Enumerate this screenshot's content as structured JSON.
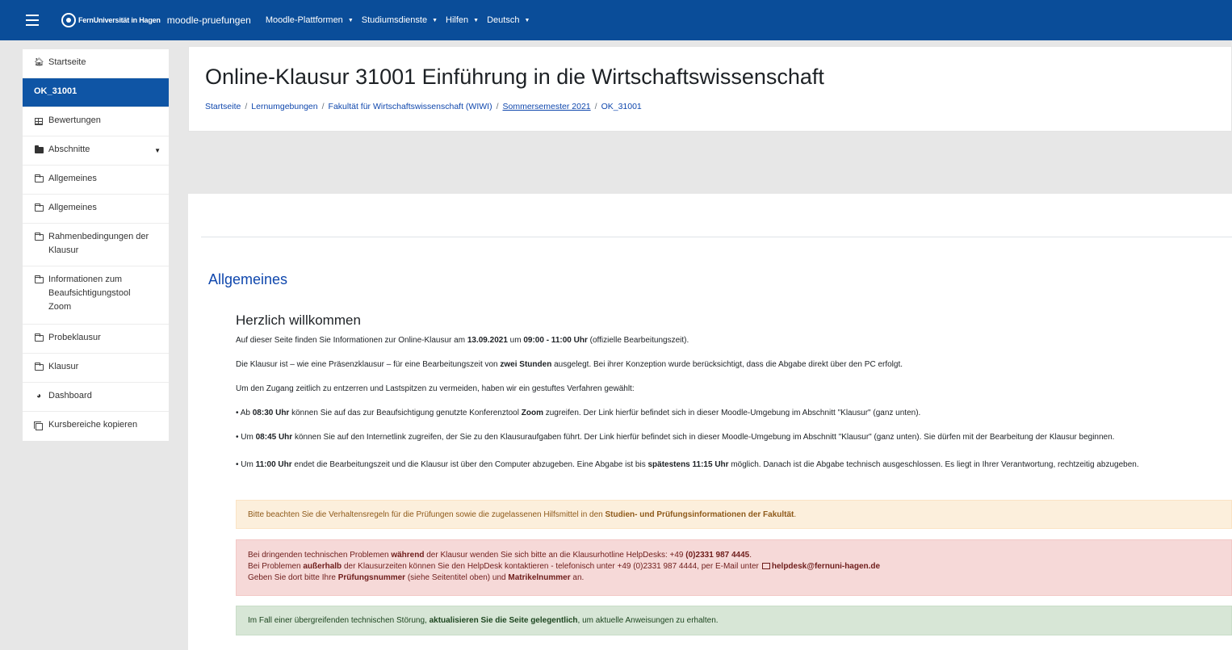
{
  "navbar": {
    "logo_text": "FernUniversität in Hagen",
    "site_name": "moodle-pruefungen",
    "menu": [
      {
        "label": "Moodle-Plattformen"
      },
      {
        "label": "Studiumsdienste"
      },
      {
        "label": "Hilfen"
      },
      {
        "label": "Deutsch"
      }
    ]
  },
  "sidebar": {
    "items": [
      {
        "label": "Startseite",
        "icon": "home-icon"
      },
      {
        "label": "OK_31001"
      },
      {
        "label": "Bewertungen",
        "icon": "table-icon"
      },
      {
        "label": "Abschnitte",
        "icon": "folder-icon"
      },
      {
        "label": "Allgemeines",
        "icon": "folder-outline-icon"
      },
      {
        "label": "Allgemeines",
        "icon": "folder-outline-icon"
      },
      {
        "label": "Rahmenbedingungen der Klausur",
        "icon": "folder-outline-icon"
      },
      {
        "label": "Informationen zum Beaufsichtigungstool Zoom",
        "icon": "folder-outline-icon"
      },
      {
        "label": "Probeklausur",
        "icon": "folder-outline-icon"
      },
      {
        "label": "Klausur",
        "icon": "folder-outline-icon"
      },
      {
        "label": "Dashboard",
        "icon": "dashboard-icon"
      },
      {
        "label": "Kursbereiche kopieren",
        "icon": "copy-icon"
      }
    ]
  },
  "header": {
    "title": "Online-Klausur 31001 Einführung in die Wirtschaftswissenschaft",
    "breadcrumb": [
      "Startseite",
      "Lernumgebungen",
      "Fakultät für Wirtschaftswissenschaft (WIWI)",
      "Sommersemester 2021",
      "OK_31001"
    ]
  },
  "section": {
    "title": "Allgemeines",
    "welcome": "Herzlich willkommen",
    "p1": {
      "a": "Auf dieser Seite finden Sie Informationen zur Online-Klausur am ",
      "b1": "13.09.2021",
      "c": " um ",
      "b2": "09:00 - 11:00 Uhr",
      "d": " (offizielle Bearbeitungszeit)."
    },
    "p2": {
      "a": "Die Klausur ist – wie eine Präsenzklausur – für eine Bearbeitungszeit von ",
      "b": "zwei Stunden",
      "c": " ausgelegt. Bei ihrer Konzeption wurde berücksichtigt, dass die Abgabe direkt über den PC erfolgt."
    },
    "p3": "Um den Zugang zeitlich zu entzerren und Lastspitzen zu vermeiden, haben wir ein gestuftes Verfahren gewählt:",
    "b1": {
      "a": "• Ab ",
      "b": "08:30 Uhr",
      "c": " können Sie auf das zur Beaufsichtigung genutzte Konferenztool ",
      "d": "Zoom",
      "e": " zugreifen. Der Link hierfür befindet sich in dieser Moodle-Umgebung im Abschnitt \"Klausur\" (ganz unten)."
    },
    "b2": {
      "a": "• Um ",
      "b": "08:45 Uhr",
      "c": " können Sie auf den Internetlink zugreifen, der Sie zu den Klausuraufgaben führt. Der Link hierfür befindet sich in dieser Moodle-Umgebung im Abschnitt \"Klausur\" (ganz unten). Sie dürfen mit der Bearbeitung der Klausur beginnen."
    },
    "b3": {
      "a": "• Um ",
      "b": "11:00 Uhr",
      "c": " endet die Bearbeitungszeit und die Klausur ist über den Computer abzugeben. Eine Abgabe ist bis ",
      "d": "spätestens 11:15 Uhr",
      "e": " möglich. Danach ist die Abgabe technisch ausgeschlossen. Es liegt in Ihrer Verantwortung, rechtzeitig abzugeben."
    },
    "warn": {
      "a": "Bitte beachten Sie die Verhaltensregeln für die Prüfungen sowie die zugelassenen Hilfsmittel in den ",
      "b": "Studien- und Prüfungsinformationen der Fakultät",
      "c": "."
    },
    "danger": {
      "l1a": "Bei dringenden technischen Problemen ",
      "l1b": "während",
      "l1c": " der Klausur wenden Sie sich bitte an die Klausurhotline HelpDesks: +49 ",
      "l1d": "(0)2331 987 4445",
      "l1e": ".",
      "l2a": "Bei Problemen ",
      "l2b": "außerhalb",
      "l2c": " der Klausurzeiten können Sie den HelpDesk kontaktieren - telefonisch unter +49 (0)2331 987 4444, per E-Mail unter",
      "l2d": "helpdesk@fernuni-hagen.de",
      "l3a": "Geben Sie dort bitte Ihre ",
      "l3b": "Prüfungsnummer",
      "l3c": " (siehe Seitentitel oben) und ",
      "l3d": "Matrikelnummer",
      "l3e": " an."
    },
    "success": {
      "a": "Im Fall einer übergreifenden technischen Störung, ",
      "b": "aktualisieren Sie die Seite gelegentlich",
      "c": ", um aktuelle Anweisungen zu erhalten."
    }
  }
}
